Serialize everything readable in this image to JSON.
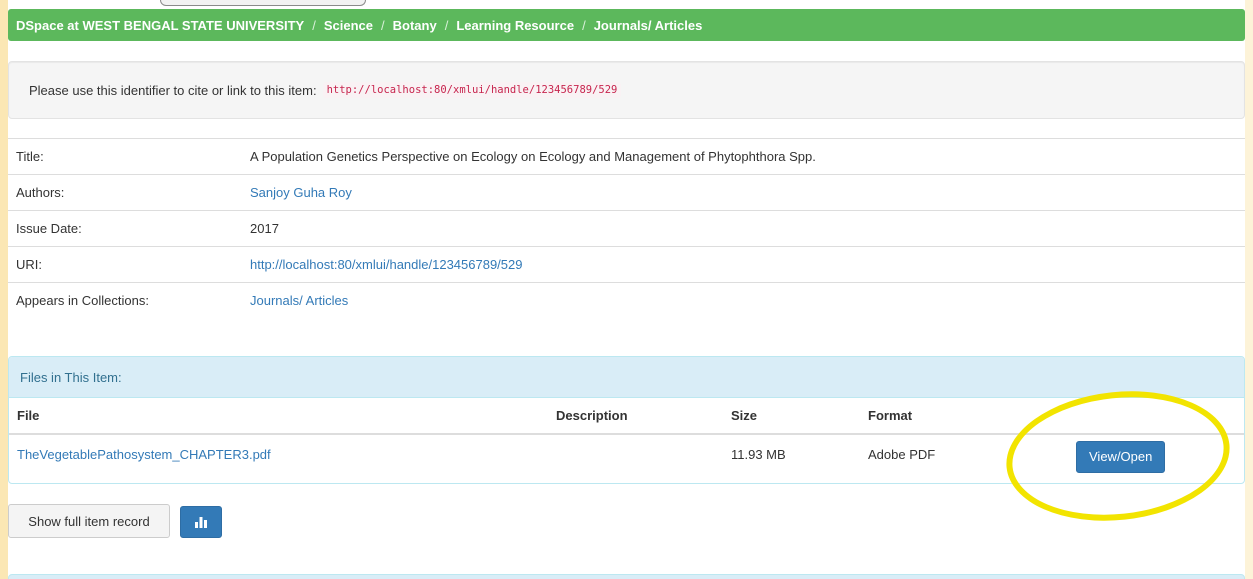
{
  "breadcrumb": {
    "items": [
      "DSpace at WEST BENGAL STATE UNIVERSITY",
      "Science",
      "Botany",
      "Learning Resource",
      "Journals/ Articles"
    ],
    "separator": "/"
  },
  "cite": {
    "text": "Please use this identifier to cite or link to this item:",
    "url": "http://localhost:80/xmlui/handle/123456789/529"
  },
  "metadata": {
    "title_label": "Title:",
    "title_value": "A Population Genetics Perspective on Ecology on Ecology and Management of Phytophthora Spp.",
    "authors_label": "Authors:",
    "authors_value": "Sanjoy Guha Roy",
    "date_label": "Issue Date:",
    "date_value": "2017",
    "uri_label": "URI:",
    "uri_value": "http://localhost:80/xmlui/handle/123456789/529",
    "collections_label": "Appears in Collections:",
    "collections_value": "Journals/ Articles"
  },
  "files": {
    "heading": "Files in This Item:",
    "columns": [
      "File",
      "Description",
      "Size",
      "Format"
    ],
    "rows": [
      {
        "file": "TheVegetablePathosystem_CHAPTER3.pdf",
        "description": "",
        "size": "11.93 MB",
        "format": "Adobe PDF",
        "action": "View/Open"
      }
    ]
  },
  "actions": {
    "show_full_record": "Show full item record"
  },
  "colors": {
    "breadcrumb_bg": "#5cb85c",
    "link": "#337ab7",
    "primary_button": "#337ab7",
    "panel_heading": "#d9edf7",
    "highlight": "#f2e400",
    "code_text": "#c7254e"
  }
}
